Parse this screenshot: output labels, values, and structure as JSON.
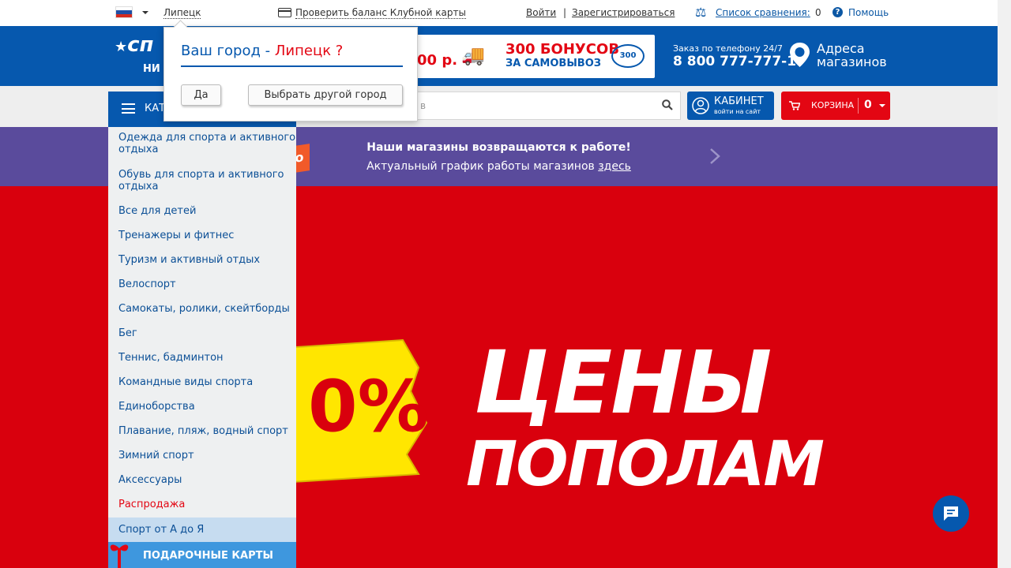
{
  "topbar": {
    "city": "Липецк",
    "balance": "Проверить баланс Клубной карты",
    "login": "Войти",
    "separator": "|",
    "register": "Зарегистрироваться",
    "compare": "Список сравнения:",
    "compare_count": "0",
    "help": "Помощь",
    "flag_colors": [
      "#ffffff",
      "#1f4fa5",
      "#d52b1e"
    ]
  },
  "header": {
    "logo_text": "сп",
    "logo_sub": "НИ Д",
    "promo_amount": "00 р.",
    "promo_bonus_line1": "300 БОНУСОВ",
    "promo_bonus_line2": "ЗА САМОВЫВОЗ",
    "promo_coin": "300",
    "phone_label": "Заказ по телефону 24/7",
    "phone": "8 800 777-777-1",
    "stores_line1": "Адреса",
    "stores_line2": "магазинов"
  },
  "nav": {
    "catalog_label": "КАТ",
    "search_placeholder": "в",
    "cabinet_title": "КАБИНЕТ",
    "cabinet_sub": "войти на сайт",
    "cart_label": "КОРЗИНА",
    "cart_count": "0"
  },
  "notice": {
    "line1": "Наши магазины возвращаются к работе!",
    "line2": "Актуальный график работы магазинов",
    "link": "здесь",
    "tag_text": "о"
  },
  "hero": {
    "title1": "ЦЕНЫ",
    "title2": "ПОПОЛАМ",
    "tag_text": "0%"
  },
  "menu": {
    "items": [
      "Одежда для спорта и активного отдыха",
      "Обувь для спорта и активного отдыха",
      "Все для детей",
      "Тренажеры и фитнес",
      "Туризм и активный отдых",
      "Велоспорт",
      "Самокаты, ролики, скейтборды",
      "Бег",
      "Теннис, бадминтон",
      "Командные виды спорта",
      "Единоборства",
      "Плавание, пляж, водный спорт",
      "Зимний спорт",
      "Аксессуары",
      "Распродажа",
      "Спорт от А до Я"
    ],
    "gift": "ПОДАРОЧНЫЕ КАРТЫ"
  },
  "popup": {
    "question_prefix": "Ваш город - ",
    "question_city": "Липецк ?",
    "yes": "Да",
    "other": "Выбрать другой город"
  },
  "colors": {
    "brand_blue": "#0658ae",
    "brand_red": "#e30613",
    "notice_purple": "#5a4b9c",
    "hero_red": "#d9000d",
    "tag_yellow": "#ffe600"
  }
}
